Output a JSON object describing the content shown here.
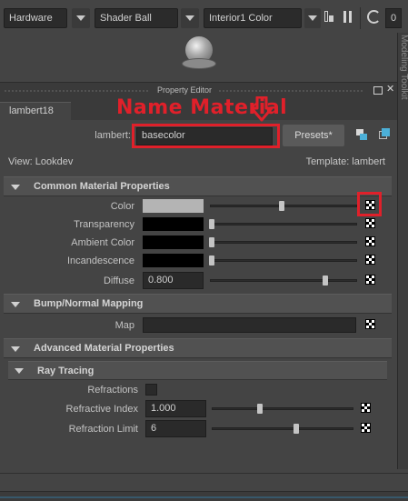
{
  "toolbar": {
    "dropdown1": "Hardware",
    "dropdown2": "Shader Ball",
    "dropdown3": "Interior1 Color",
    "counter": "0"
  },
  "panel": {
    "title": "Property Editor",
    "side_tab": "Modeling Toolkit"
  },
  "editor": {
    "tab": "lambert18",
    "name_label": "lambert:",
    "name_value": "basecolor",
    "presets_label": "Presets*",
    "view_label": "View: Lookdev",
    "template_label": "Template: lambert"
  },
  "annotation": {
    "text": "Name Material",
    "color": "#e0202a"
  },
  "sections": {
    "common": "Common Material Properties",
    "bump": "Bump/Normal Mapping",
    "advanced": "Advanced Material Properties",
    "raytracing": "Ray Tracing"
  },
  "attributes": {
    "color": {
      "label": "Color",
      "swatch": "#b4b4b4",
      "level": 0.46
    },
    "transparency": {
      "label": "Transparency",
      "swatch": "#000000",
      "level": 0.0
    },
    "ambient": {
      "label": "Ambient Color",
      "swatch": "#000000",
      "level": 0.0
    },
    "incandescence": {
      "label": "Incandescence",
      "swatch": "#000000",
      "level": 0.0
    },
    "diffuse": {
      "label": "Diffuse",
      "value": "0.800",
      "level": 0.8
    },
    "map": {
      "label": "Map"
    },
    "refractions": {
      "label": "Refractions"
    },
    "refractive_index": {
      "label": "Refractive Index",
      "value": "1.000",
      "level": 0.33
    },
    "refraction_limit": {
      "label": "Refraction Limit",
      "value": "6",
      "level": 0.6
    }
  }
}
